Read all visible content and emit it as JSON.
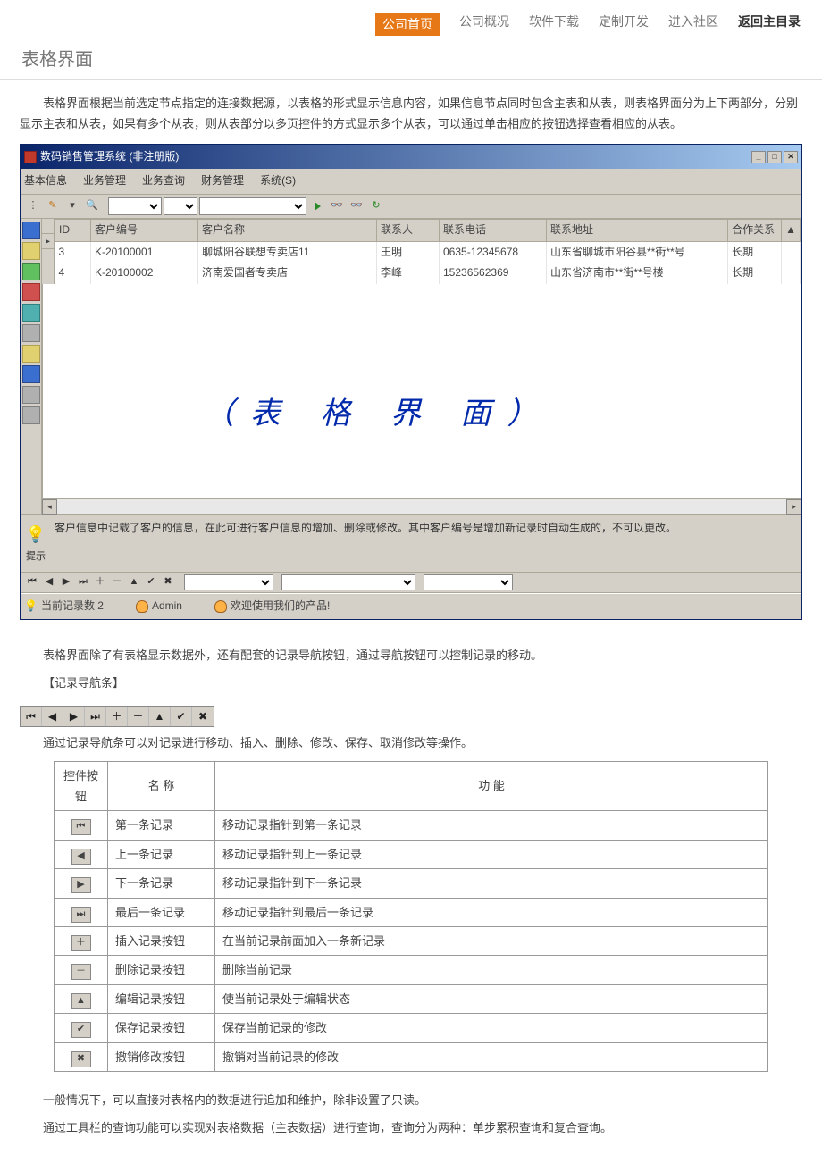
{
  "nav": {
    "items": [
      "公司首页",
      "公司概况",
      "软件下载",
      "定制开发",
      "进入社区",
      "返回主目录"
    ],
    "active": 0,
    "bold": 5
  },
  "page_title": "表格界面",
  "intro": "表格界面根据当前选定节点指定的连接数据源，以表格的形式显示信息内容，如果信息节点同时包含主表和从表，则表格界面分为上下两部分，分别显示主表和从表，如果有多个从表，则从表部分以多页控件的方式显示多个从表，可以通过单击相应的按钮选择查看相应的从表。",
  "app": {
    "title": "数码销售管理系统 (非注册版)",
    "menus": [
      "基本信息",
      "业务管理",
      "业务查询",
      "财务管理",
      "系统(S)"
    ],
    "grid": {
      "headers": [
        "ID",
        "客户编号",
        "客户名称",
        "联系人",
        "联系电话",
        "联系地址",
        "合作关系"
      ],
      "rows": [
        {
          "id": "3",
          "no": "K-20100001",
          "name": "聊城阳谷联想专卖店11",
          "contact": "王明",
          "phone": "0635-12345678",
          "addr": "山东省聊城市阳谷县**街**号",
          "rel": "长期"
        },
        {
          "id": "4",
          "no": "K-20100002",
          "name": "济南爱国者专卖店",
          "contact": "李峰",
          "phone": "15236562369",
          "addr": "山东省济南市**街**号楼",
          "rel": "长期"
        }
      ]
    },
    "watermark": "（表 格 界 面）",
    "hint_label": "提示",
    "hint": "客户信息中记载了客户的信息，在此可进行客户信息的增加、删除或修改。其中客户编号是增加新记录时自动生成的，不可以更改。",
    "status": {
      "records": "当前记录数 2",
      "user": "Admin",
      "welcome": "欢迎使用我们的产品!"
    }
  },
  "para2": "表格界面除了有表格显示数据外，还有配套的记录导航按钮，通过导航按钮可以控制记录的移动。",
  "nav_heading": "【记录导航条】",
  "para3": "通过记录导航条可以对记录进行移动、插入、删除、修改、保存、取消修改等操作。",
  "desc_table": {
    "headers": [
      "控件按钮",
      "名    称",
      "功             能"
    ],
    "rows": [
      {
        "icon": "⏮",
        "name": "第一条记录",
        "func": "移动记录指针到第一条记录"
      },
      {
        "icon": "◀",
        "name": "上一条记录",
        "func": "移动记录指针到上一条记录"
      },
      {
        "icon": "▶",
        "name": "下一条记录",
        "func": "移动记录指针到下一条记录"
      },
      {
        "icon": "⏭",
        "name": "最后一条记录",
        "func": "移动记录指针到最后一条记录"
      },
      {
        "icon": "＋",
        "name": "插入记录按钮",
        "func": "在当前记录前面加入一条新记录"
      },
      {
        "icon": "－",
        "name": "删除记录按钮",
        "func": "删除当前记录"
      },
      {
        "icon": "▲",
        "name": "编辑记录按钮",
        "func": "使当前记录处于编辑状态"
      },
      {
        "icon": "✔",
        "name": "保存记录按钮",
        "func": "保存当前记录的修改"
      },
      {
        "icon": "✖",
        "name": "撤销修改按钮",
        "func": "撤销对当前记录的修改"
      }
    ]
  },
  "para4": "一般情况下，可以直接对表格内的数据进行追加和维护，除非设置了只读。",
  "para5": "通过工具栏的查询功能可以实现对表格数据（主表数据）进行查询，查询分为两种：单步累积查询和复合查询。"
}
